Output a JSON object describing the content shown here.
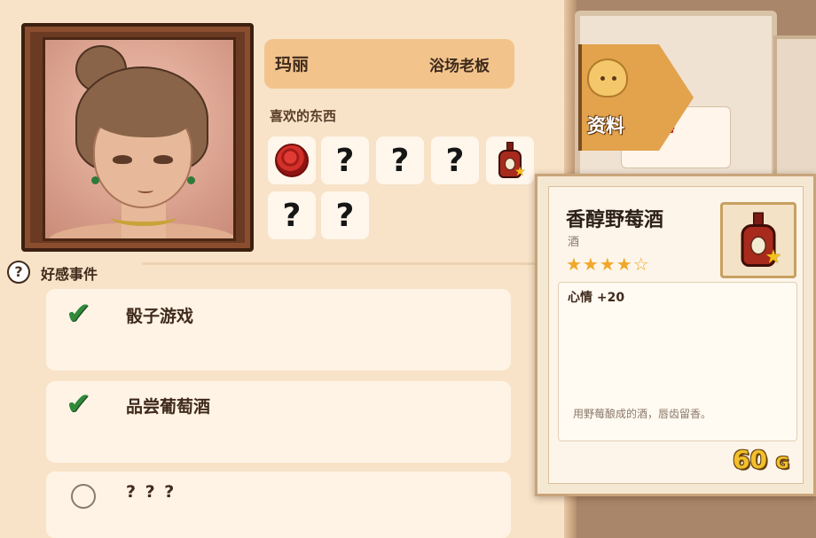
{
  "character": {
    "name": "玛丽",
    "role": "浴场老板"
  },
  "likes": {
    "title": "喜欢的东西",
    "items": [
      {
        "type": "rose-icon"
      },
      {
        "type": "unknown",
        "mark": "?"
      },
      {
        "type": "unknown",
        "mark": "?"
      },
      {
        "type": "unknown",
        "mark": "?"
      },
      {
        "type": "wine-bottle-icon"
      },
      {
        "type": "unknown",
        "mark": "?"
      },
      {
        "type": "unknown",
        "mark": "?"
      }
    ]
  },
  "events": {
    "title": "好感事件",
    "help_icon": "?",
    "items": [
      {
        "title": "骰子游戏",
        "status": "completed"
      },
      {
        "title": "品尝葡萄酒",
        "status": "completed"
      },
      {
        "title": "? ? ?",
        "status": "locked"
      }
    ]
  },
  "side_tab": {
    "label": "资料"
  },
  "tooltip": {
    "name": "香醇野莓酒",
    "category": "酒",
    "rating": 4,
    "rating_max": 5,
    "stars_text": "★★★★☆",
    "effect": "心情 +20",
    "description": "用野莓酿成的酒，唇齿留香。",
    "price": "60",
    "currency": "G"
  },
  "colors": {
    "panel": "#f8e3c8",
    "name_plate": "#f2c48c",
    "check_green": "#2f8a3a",
    "price_gold": "#f2c02a",
    "star_gold": "#f0a82a"
  }
}
